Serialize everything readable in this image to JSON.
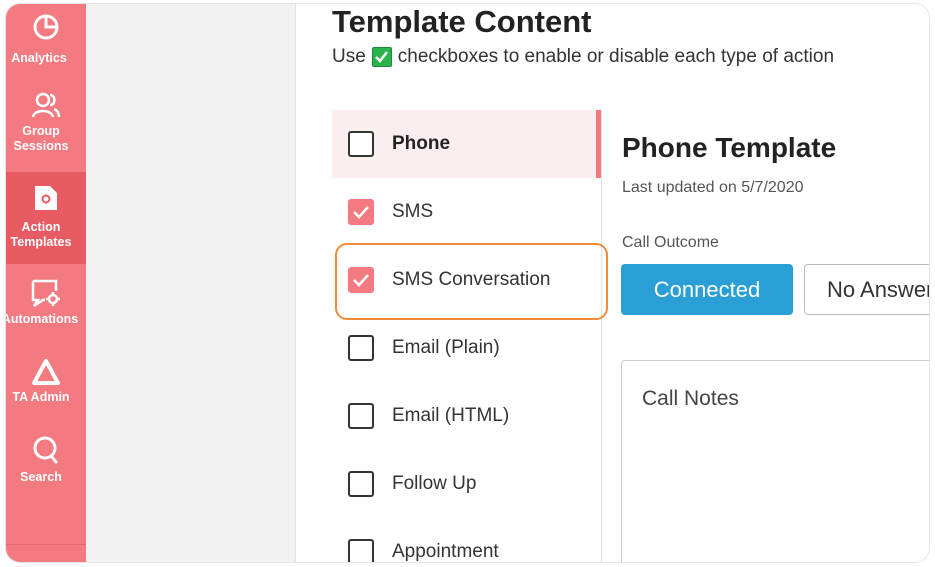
{
  "sidebar": {
    "items": [
      {
        "label": "Analytics",
        "icon": "pie-chart-icon"
      },
      {
        "label": "Group Sessions",
        "icon": "users-icon"
      },
      {
        "label": "Action Templates",
        "icon": "document-gear-icon",
        "active": true
      },
      {
        "label": "Automations",
        "icon": "message-gear-icon"
      },
      {
        "label": "TA Admin",
        "icon": "triangle-icon"
      },
      {
        "label": "Search",
        "icon": "search-icon"
      }
    ]
  },
  "main": {
    "title": "Template Content",
    "subtitle_before": "Use",
    "subtitle_after": "checkboxes to enable or disable each type of action",
    "action_types": [
      {
        "label": "Phone",
        "checked": false,
        "selected": true
      },
      {
        "label": "SMS",
        "checked": true
      },
      {
        "label": "SMS Conversation",
        "checked": true,
        "highlighted": true
      },
      {
        "label": "Email (Plain)",
        "checked": false
      },
      {
        "label": "Email (HTML)",
        "checked": false
      },
      {
        "label": "Follow Up",
        "checked": false
      },
      {
        "label": "Appointment",
        "checked": false
      }
    ],
    "detail": {
      "title": "Phone Template",
      "updated": "Last updated on 5/7/2020",
      "outcome_label": "Call Outcome",
      "outcome_options": [
        "Connected",
        "No Answer"
      ],
      "selected_outcome": "Connected",
      "notes_label": "Call Notes"
    }
  },
  "colors": {
    "sidebar": "#f27a80",
    "sidebar_active": "#e85b63",
    "checkbox_checked": "#f27a80",
    "primary_button": "#2a9fd6",
    "highlight_outline": "#f28a3a",
    "green_check": "#2bb24c"
  }
}
